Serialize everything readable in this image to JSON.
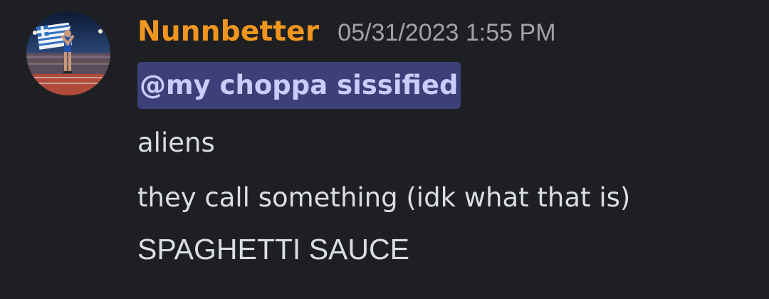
{
  "message": {
    "author": "Nunnbetter",
    "timestamp": "05/31/2023 1:55 PM",
    "mention": "@my choppa sissified",
    "lines": [
      "aliens",
      "they call something (idk what that is)",
      "SPAGHETTI SAUCE"
    ]
  },
  "colors": {
    "background": "#1e1f22",
    "username": "#f0961e",
    "timestamp": "#a2a3a9",
    "mention_bg": "#3c3f78",
    "mention_text": "#c9cdfb",
    "message_text": "#dbdee1"
  }
}
